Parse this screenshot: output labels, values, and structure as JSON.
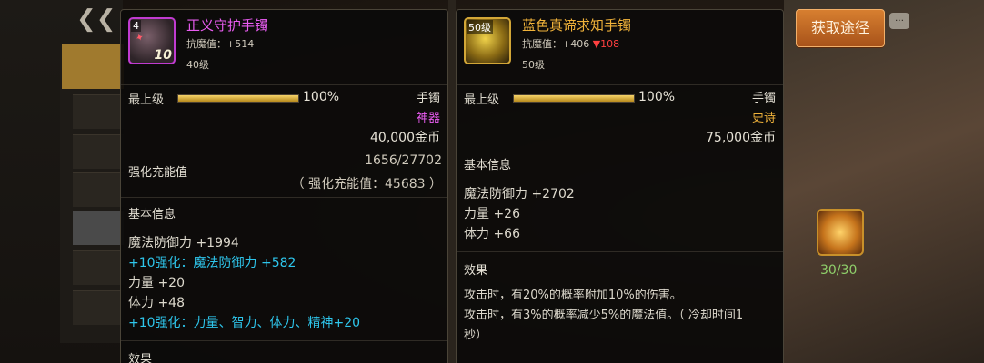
{
  "acquire_button": "获取途径",
  "bg_counter": "30/30",
  "left_item": {
    "icon_badge": "4",
    "icon_number": "10",
    "name": "正义守护手镯",
    "anti_magic": "抗魔值：+514",
    "level": "40级",
    "max_level_label": "最上级",
    "progress_percent": 100,
    "progress_text": "100%",
    "slot": "手镯",
    "rarity": "神器",
    "price": "40,000金币",
    "enhance_label": "强化充能值",
    "enhance_value": "1656/27702",
    "enhance_sub": "（ 强化充能值：45683 ）",
    "basic_info_label": "基本信息",
    "stats": [
      {
        "text": "魔法防御力 +1994",
        "color": "normal"
      },
      {
        "text": "+10强化：魔法防御力 +582",
        "color": "cyan"
      },
      {
        "text": "力量 +20",
        "color": "normal"
      },
      {
        "text": "体力 +48",
        "color": "normal"
      },
      {
        "text": "+10强化：力量、智力、体力、精神+20",
        "color": "cyan"
      }
    ],
    "effect_label": "效果"
  },
  "right_item": {
    "icon_badge": "50级",
    "name": "蓝色真谛求知手镯",
    "anti_magic_prefix": "抗魔值：+406 ",
    "anti_magic_down": "▼108",
    "level": "50级",
    "max_level_label": "最上级",
    "progress_percent": 100,
    "progress_text": "100%",
    "slot": "手镯",
    "rarity": "史诗",
    "price": "75,000金币",
    "basic_info_label": "基本信息",
    "stats": [
      {
        "text": "魔法防御力 +2702"
      },
      {
        "text": "力量 +26"
      },
      {
        "text": "体力 +66"
      }
    ],
    "effect_label": "效果",
    "effects": [
      "攻击时，有20%的概率附加10%的伤害。",
      "攻击时，有3%的概率减少5%的魔法值。（ 冷却时间1",
      "秒）"
    ]
  },
  "colors": {
    "epic": "#e85cf0",
    "legend": "#f0b23a",
    "cyan": "#2ec6ec",
    "down": "#ff4040",
    "button": "#c06a24"
  }
}
